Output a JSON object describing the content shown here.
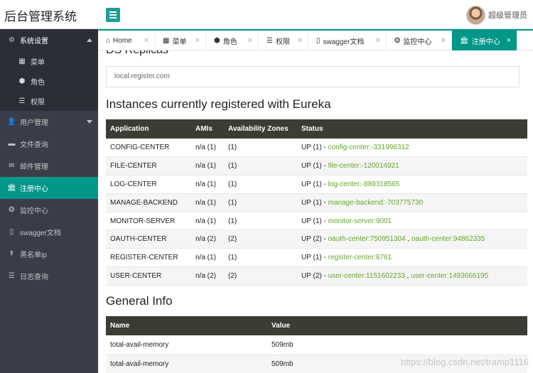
{
  "app": {
    "title": "后台管理系统"
  },
  "user": {
    "name": "超级管理员"
  },
  "sidebar": {
    "items": [
      {
        "label": "系统设置",
        "icon": "gears-icon",
        "glyph": "⚙",
        "expanded": true,
        "children": [
          {
            "label": "菜单",
            "icon": "windows-icon",
            "glyph": "▦"
          },
          {
            "label": "角色",
            "icon": "cubes-icon",
            "glyph": "⬢"
          },
          {
            "label": "权限",
            "icon": "list-icon",
            "glyph": "☰"
          }
        ]
      },
      {
        "label": "用户管理",
        "icon": "user-icon",
        "glyph": "👤",
        "expandable": true
      },
      {
        "label": "文件查询",
        "icon": "folder-icon",
        "glyph": "▬"
      },
      {
        "label": "邮件管理",
        "icon": "envelope-icon",
        "glyph": "✉"
      },
      {
        "label": "注册中心",
        "icon": "bank-icon",
        "glyph": "🏛",
        "active": true
      },
      {
        "label": "监控中心",
        "icon": "spinner-icon",
        "glyph": "❂"
      },
      {
        "label": "swagger文档",
        "icon": "file-icon",
        "glyph": "▯"
      },
      {
        "label": "黑名单ip",
        "icon": "pin-icon",
        "glyph": "↟"
      },
      {
        "label": "日志查询",
        "icon": "list-icon",
        "glyph": "☰"
      }
    ]
  },
  "tabs": [
    {
      "label": "Home",
      "icon": "home-icon",
      "glyph": "⌂",
      "width": 80
    },
    {
      "label": "菜单",
      "icon": "windows-icon",
      "glyph": "▦",
      "width": 72
    },
    {
      "label": "角色",
      "icon": "cubes-icon",
      "glyph": "⬢",
      "width": 74
    },
    {
      "label": "权限",
      "icon": "list-icon",
      "glyph": "☰",
      "width": 70
    },
    {
      "label": "swagger文档",
      "icon": "file-icon",
      "glyph": "▯",
      "width": 110
    },
    {
      "label": "监控中心",
      "icon": "spinner-icon",
      "glyph": "❂",
      "width": 92
    },
    {
      "label": "注册中心",
      "icon": "bank-icon",
      "glyph": "🏛",
      "width": 92,
      "active": true
    }
  ],
  "main": {
    "cut_heading": "DS Replicas",
    "register_url": "local.register.com",
    "instances_title": "Instances currently registered with Eureka",
    "instances_columns": [
      "Application",
      "AMIs",
      "Availability Zones",
      "Status"
    ],
    "instances": [
      {
        "app": "CONFIG-CENTER",
        "amis": "n/a (1)",
        "zones": "(1)",
        "status": "UP (1) - ",
        "links": [
          "config-center:-331996312"
        ]
      },
      {
        "app": "FILE-CENTER",
        "amis": "n/a (1)",
        "zones": "(1)",
        "status": "UP (1) - ",
        "links": [
          "file-center:-120014921"
        ]
      },
      {
        "app": "LOG-CENTER",
        "amis": "n/a (1)",
        "zones": "(1)",
        "status": "UP (1) - ",
        "links": [
          "log-center:-889318565"
        ]
      },
      {
        "app": "MANAGE-BACKEND",
        "amis": "n/a (1)",
        "zones": "(1)",
        "status": "UP (1) - ",
        "links": [
          "manage-backend:-703775730"
        ]
      },
      {
        "app": "MONITOR-SERVER",
        "amis": "n/a (1)",
        "zones": "(1)",
        "status": "UP (1) - ",
        "links": [
          "monitor-server:9001"
        ]
      },
      {
        "app": "OAUTH-CENTER",
        "amis": "n/a (2)",
        "zones": "(2)",
        "status": "UP (2) - ",
        "links": [
          "oauth-center:750951304",
          "oauth-center:94862335"
        ]
      },
      {
        "app": "REGISTER-CENTER",
        "amis": "n/a (1)",
        "zones": "(1)",
        "status": "UP (1) - ",
        "links": [
          "register-center:8761"
        ]
      },
      {
        "app": "USER-CENTER",
        "amis": "n/a (2)",
        "zones": "(2)",
        "status": "UP (2) - ",
        "links": [
          "user-center:1151602233",
          "user-center:1493666195"
        ]
      }
    ],
    "general_title": "General Info",
    "general_columns": [
      "Name",
      "Value"
    ],
    "general_rows": [
      {
        "name": "total-avail-memory",
        "value": "509mb"
      },
      {
        "name": "total-avail-memory",
        "value": "509mb"
      }
    ]
  },
  "watermark": "https://blog.csdn.net/tramp1116",
  "colors": {
    "accent": "#009688",
    "sidebar": "#393d49",
    "table_header": "#3c3c35",
    "link": "#67a52e"
  }
}
